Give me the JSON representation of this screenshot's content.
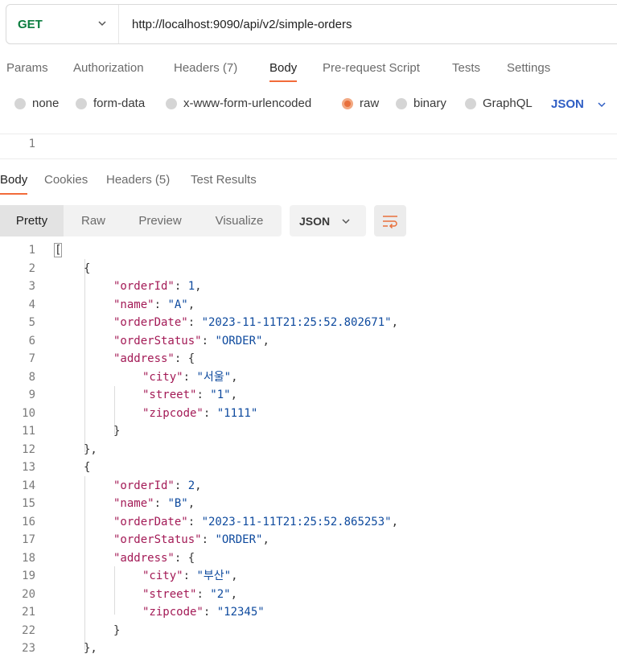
{
  "request": {
    "method": "GET",
    "url": "http://localhost:9090/api/v2/simple-orders"
  },
  "request_tabs": [
    "Params",
    "Authorization",
    "Headers (7)",
    "Body",
    "Pre-request Script",
    "Tests",
    "Settings"
  ],
  "body_types": [
    "none",
    "form-data",
    "x-www-form-urlencoded",
    "raw",
    "binary",
    "GraphQL"
  ],
  "body_format": "JSON",
  "request_editor": {
    "line": "1"
  },
  "response_tabs": [
    "Body",
    "Cookies",
    "Headers (5)",
    "Test Results"
  ],
  "view_modes": [
    "Pretty",
    "Raw",
    "Preview",
    "Visualize"
  ],
  "response_format": "JSON",
  "response_lines": [
    "1",
    "2",
    "3",
    "4",
    "5",
    "6",
    "7",
    "8",
    "9",
    "10",
    "11",
    "12",
    "13",
    "14",
    "15",
    "16",
    "17",
    "18",
    "19",
    "20",
    "21",
    "22",
    "23"
  ],
  "orders": [
    {
      "orderId": "1",
      "name": "\"A\"",
      "orderDate": "\"2023-11-11T21:25:52.802671\"",
      "orderStatus": "\"ORDER\"",
      "city": "\"서울\"",
      "street": "\"1\"",
      "zipcode": "\"1111\""
    },
    {
      "orderId": "2",
      "name": "\"B\"",
      "orderDate": "\"2023-11-11T21:25:52.865253\"",
      "orderStatus": "\"ORDER\"",
      "city": "\"부산\"",
      "street": "\"2\"",
      "zipcode": "\"12345\""
    }
  ],
  "keys": {
    "orderId": "\"orderId\"",
    "name": "\"name\"",
    "orderDate": "\"orderDate\"",
    "orderStatus": "\"orderStatus\"",
    "address": "\"address\"",
    "city": "\"city\"",
    "street": "\"street\"",
    "zipcode": "\"zipcode\""
  },
  "colors": {
    "accent": "#f26b3a",
    "method": "#0a7d3e",
    "json_key": "#a31a56",
    "json_value": "#0e4a9e"
  }
}
